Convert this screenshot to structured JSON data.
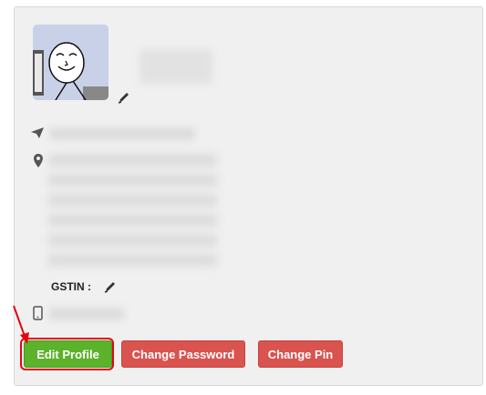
{
  "profile": {
    "gstin_label": "GSTIN :"
  },
  "actions": {
    "edit_profile": "Edit Profile",
    "change_password": "Change Password",
    "change_pin": "Change Pin"
  },
  "icons": {
    "edit": "pencil-icon",
    "email": "paper-plane-icon",
    "address": "map-marker-icon",
    "phone": "mobile-phone-icon"
  },
  "colors": {
    "primary_action": "#5cb22b",
    "secondary_action": "#d9534f",
    "highlight": "#e30613",
    "card_background": "#f0f0f0"
  }
}
